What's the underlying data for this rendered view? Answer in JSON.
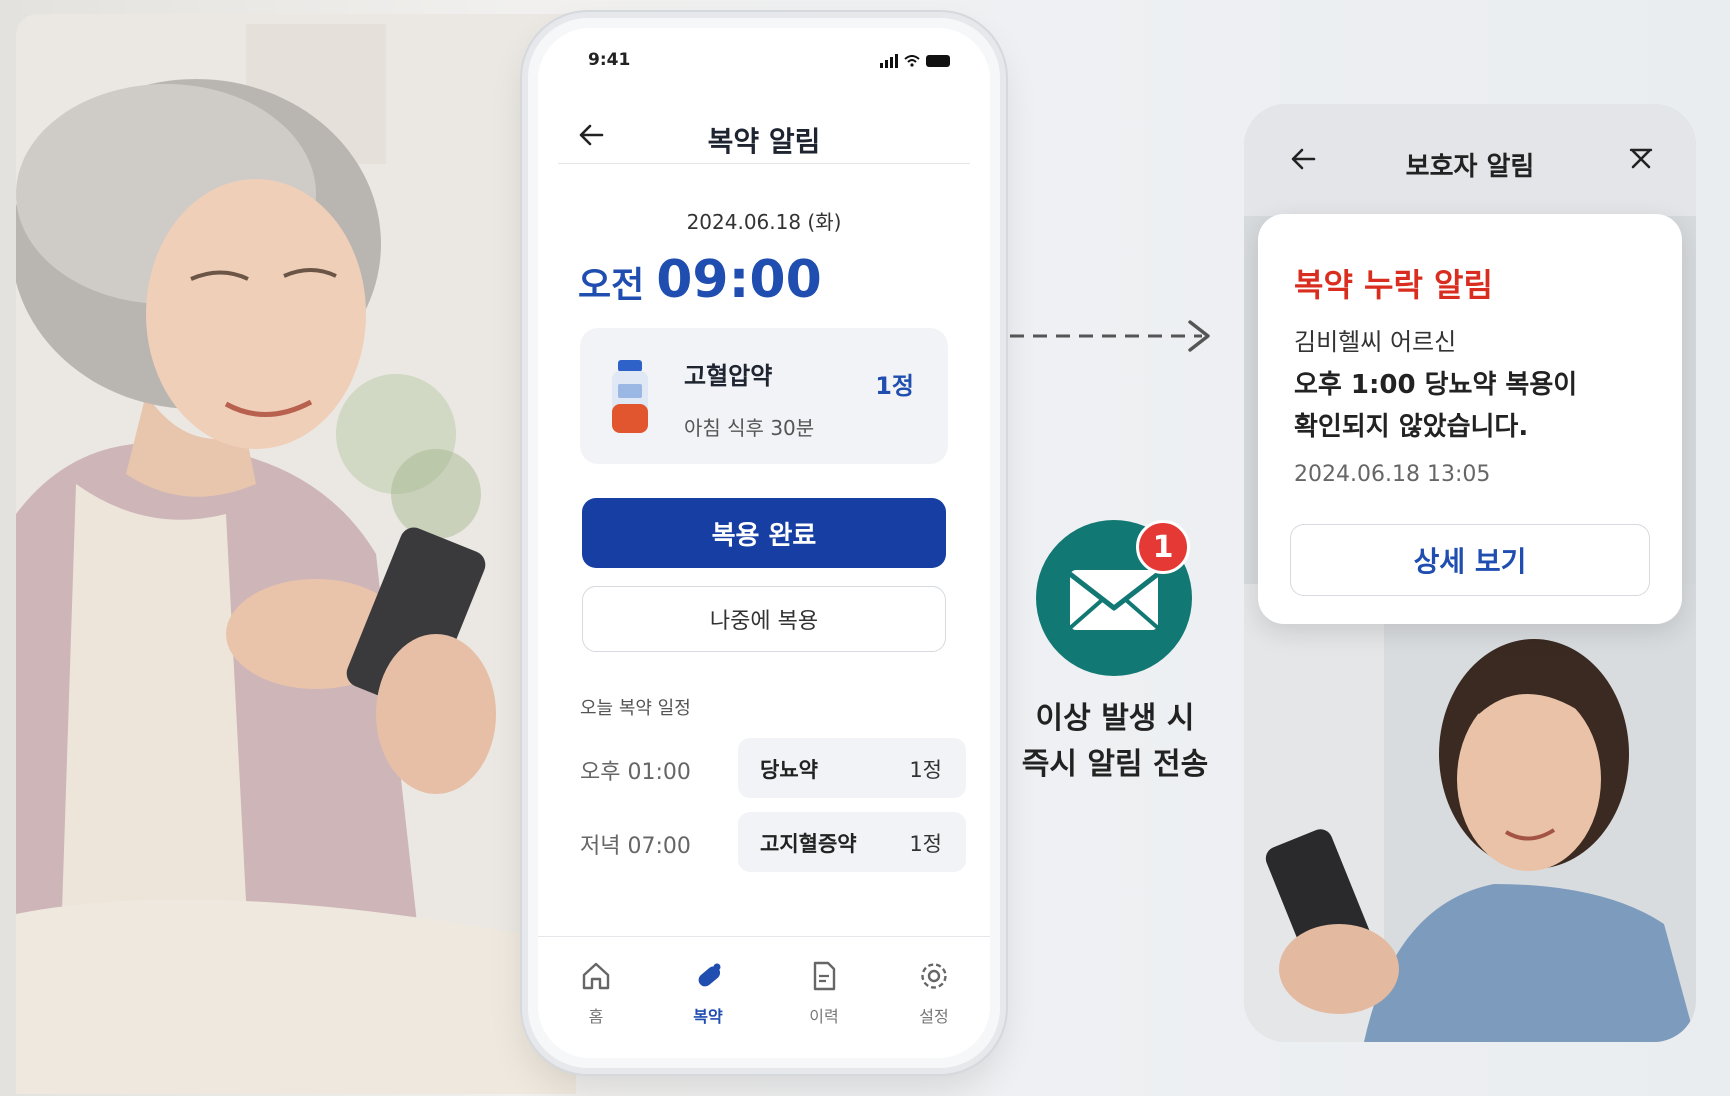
{
  "phone": {
    "status_time": "9:41",
    "header": {
      "title": "복약 알림"
    },
    "date": "2024.06.18 (화)",
    "time": {
      "ampm": "오전",
      "value": "09:00"
    },
    "medication": {
      "name": "고혈압약",
      "quantity": "1정",
      "timing": "아침 식후 30분"
    },
    "buttons": {
      "done": "복용 완료",
      "later": "나중에 복용"
    },
    "schedule": {
      "title": "오늘 복약 일정",
      "items": [
        {
          "time": "오후 01:00",
          "name": "당뇨약",
          "quantity": "1정"
        },
        {
          "time": "저녁 07:00",
          "name": "고지혈증약",
          "quantity": "1정"
        }
      ]
    },
    "tabs": [
      {
        "label": "홈",
        "icon": "home-icon"
      },
      {
        "label": "복약",
        "icon": "pill-icon"
      },
      {
        "label": "이력",
        "icon": "document-icon"
      },
      {
        "label": "설정",
        "icon": "gear-icon"
      }
    ],
    "colors": {
      "primary": "#173fa3",
      "accent_text": "#1f4eb0"
    }
  },
  "notification": {
    "badge_count": "1",
    "caption_line1": "이상 발생 시",
    "caption_line2": "즉시 알림 전송",
    "icon": "envelope-icon",
    "circle_color": "#127873",
    "badge_color": "#e53935"
  },
  "guardian": {
    "header": {
      "title": "보호자 알림"
    },
    "alert": {
      "title": "복약 누락 알림",
      "who": "김비헬씨 어르신",
      "message_line1": "오후 1:00 당뇨약 복용이",
      "message_line2": "확인되지 않았습니다.",
      "timestamp": "2024.06.18 13:05",
      "button": "상세 보기",
      "title_color": "#d92d20"
    }
  }
}
